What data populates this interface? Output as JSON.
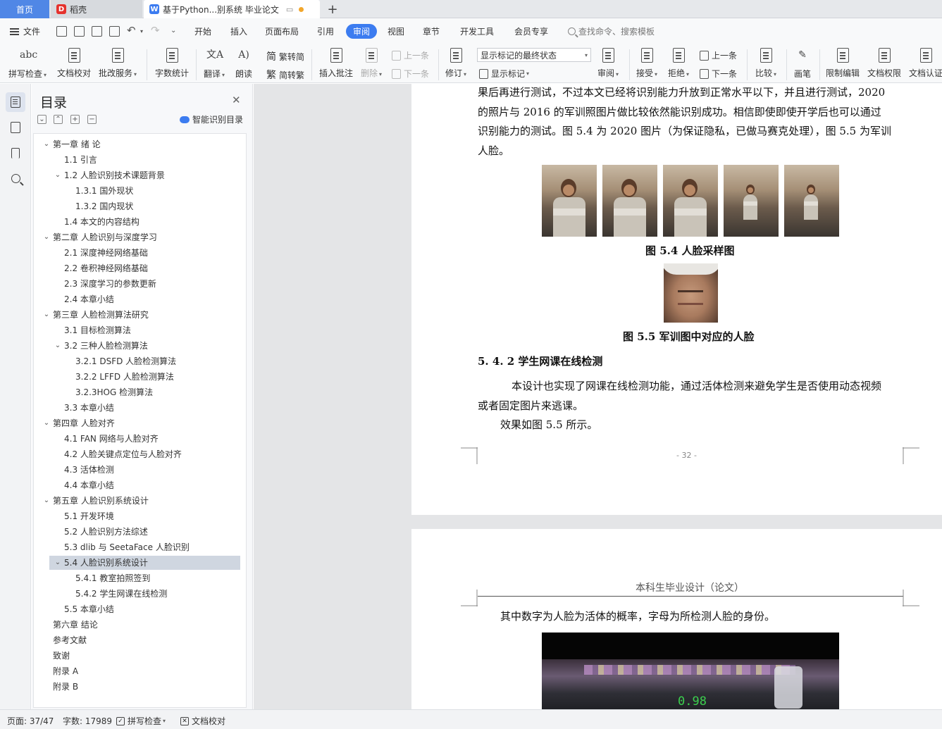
{
  "tabs": {
    "home": "首页",
    "daoke": "稻壳",
    "doc": "基于Python...别系统 毕业论文"
  },
  "menu": {
    "file": "文件",
    "items": [
      "开始",
      "插入",
      "页面布局",
      "引用",
      "审阅",
      "视图",
      "章节",
      "开发工具",
      "会员专享"
    ],
    "search_placeholder": "查找命令、搜索模板"
  },
  "ribbon": {
    "spell_check": "拼写检查",
    "doc_proof": "文档校对",
    "revise_service": "批改服务",
    "word_count": "字数统计",
    "translate": "翻译",
    "read_aloud": "朗读",
    "trad_to_simp": "繁转简",
    "simp_to_trad": "简转繁",
    "insert_comment": "插入批注",
    "delete": "删除",
    "prev": "上一条",
    "next": "下一条",
    "track_changes": "修订",
    "markup_state": "显示标记的最终状态",
    "show_markup": "显示标记",
    "review": "审阅",
    "accept": "接受",
    "reject": "拒绝",
    "prev2": "上一条",
    "next2": "下一条",
    "compare": "比较",
    "ink": "画笔",
    "restrict_edit": "限制编辑",
    "doc_permission": "文档权限",
    "doc_certify": "文档认证"
  },
  "toc": {
    "title": "目录",
    "smart": "智能识别目录",
    "items": [
      {
        "label": "第一章  绪  论",
        "level": 1,
        "caret": "v"
      },
      {
        "label": "1.1  引言",
        "level": 2,
        "caret": ""
      },
      {
        "label": "1.2  人脸识别技术课题背景",
        "level": 2,
        "caret": "v"
      },
      {
        "label": "1.3.1  国外现状",
        "level": 3,
        "caret": ""
      },
      {
        "label": "1.3.2  国内现状",
        "level": 3,
        "caret": ""
      },
      {
        "label": "1.4  本文的内容结构",
        "level": 2,
        "caret": ""
      },
      {
        "label": "第二章  人脸识别与深度学习",
        "level": 1,
        "caret": "v"
      },
      {
        "label": "2.1 深度神经网络基础",
        "level": 2,
        "caret": ""
      },
      {
        "label": "2.2 卷积神经网络基础",
        "level": 2,
        "caret": ""
      },
      {
        "label": "2.3  深度学习的参数更新",
        "level": 2,
        "caret": ""
      },
      {
        "label": "2.4 本章小结",
        "level": 2,
        "caret": ""
      },
      {
        "label": "第三章  人脸检测算法研究",
        "level": 1,
        "caret": "v"
      },
      {
        "label": "3.1 目标检测算法",
        "level": 2,
        "caret": ""
      },
      {
        "label": "3.2 三种人脸检测算法",
        "level": 2,
        "caret": "v"
      },
      {
        "label": "3.2.1 DSFD 人脸检测算法",
        "level": 3,
        "caret": ""
      },
      {
        "label": "3.2.2 LFFD 人脸检测算法",
        "level": 3,
        "caret": ""
      },
      {
        "label": "3.2.3HOG 检测算法",
        "level": 3,
        "caret": ""
      },
      {
        "label": "3.3  本章小结",
        "level": 2,
        "caret": ""
      },
      {
        "label": "第四章  人脸对齐",
        "level": 1,
        "caret": "v"
      },
      {
        "label": "4.1 FAN 网络与人脸对齐",
        "level": 2,
        "caret": ""
      },
      {
        "label": "4.2 人脸关键点定位与人脸对齐",
        "level": 2,
        "caret": ""
      },
      {
        "label": "4.3 活体检测",
        "level": 2,
        "caret": ""
      },
      {
        "label": "4.4  本章小结",
        "level": 2,
        "caret": ""
      },
      {
        "label": "第五章  人脸识别系统设计",
        "level": 1,
        "caret": "v"
      },
      {
        "label": "5.1  开发环境",
        "level": 2,
        "caret": ""
      },
      {
        "label": "5.2 人脸识别方法综述",
        "level": 2,
        "caret": ""
      },
      {
        "label": "5.3 dlib 与 SeetaFace 人脸识别",
        "level": 2,
        "caret": ""
      },
      {
        "label": "5.4  人脸识别系统设计",
        "level": 2,
        "caret": "v",
        "selected": true
      },
      {
        "label": "5.4.1  教室拍照签到",
        "level": 3,
        "caret": ""
      },
      {
        "label": "5.4.2  学生网课在线检测",
        "level": 3,
        "caret": ""
      },
      {
        "label": "5.5 本章小结",
        "level": 2,
        "caret": ""
      },
      {
        "label": "第六章  结论",
        "level": 1,
        "caret": ""
      },
      {
        "label": "参考文献",
        "level": 1,
        "caret": ""
      },
      {
        "label": "致谢",
        "level": 1,
        "caret": ""
      },
      {
        "label": "附录 A",
        "level": 1,
        "caret": ""
      },
      {
        "label": "附录 B",
        "level": 1,
        "caret": ""
      }
    ]
  },
  "document": {
    "para1_lines": [
      "果后再进行测试，不过本文已经将识别能力升放到正常水平以下，并且进行测试，2020",
      "的照片与 2016 的军训照图片做比较依然能识别成功。相信即使即使开学后也可以通过",
      "识别能力的测试。图 5.4 为 2020 图片（为保证隐私，已做马赛克处理），图 5.5 为军训",
      "人脸。"
    ],
    "fig54_caption": "图 5.4  人脸采样图",
    "fig55_caption": "图 5.5  军训图中对应的人脸",
    "section_542": "5. 4. 2  学生网课在线检测",
    "para2_lines": [
      "本设计也实现了网课在线检测功能，通过活体检测来避免学生是否使用动态视频",
      "或者固定图片来逃课。"
    ],
    "para3": "效果如图 5.5 所示。",
    "page_number": "- 32 -",
    "header": "本科生毕业设计（论文）",
    "para4": "其中数字为人脸为活体的概率，字母为所检测人脸的身份。",
    "liveness_score": "0.98"
  },
  "status": {
    "page": "页面: 37/47",
    "words": "字数: 17989",
    "spell": "拼写检查",
    "proof": "文档校对"
  },
  "colors": {
    "accent": "#3c7cf0",
    "selected_row": "#cfd6e0",
    "score_green": "#3ccf4e"
  }
}
